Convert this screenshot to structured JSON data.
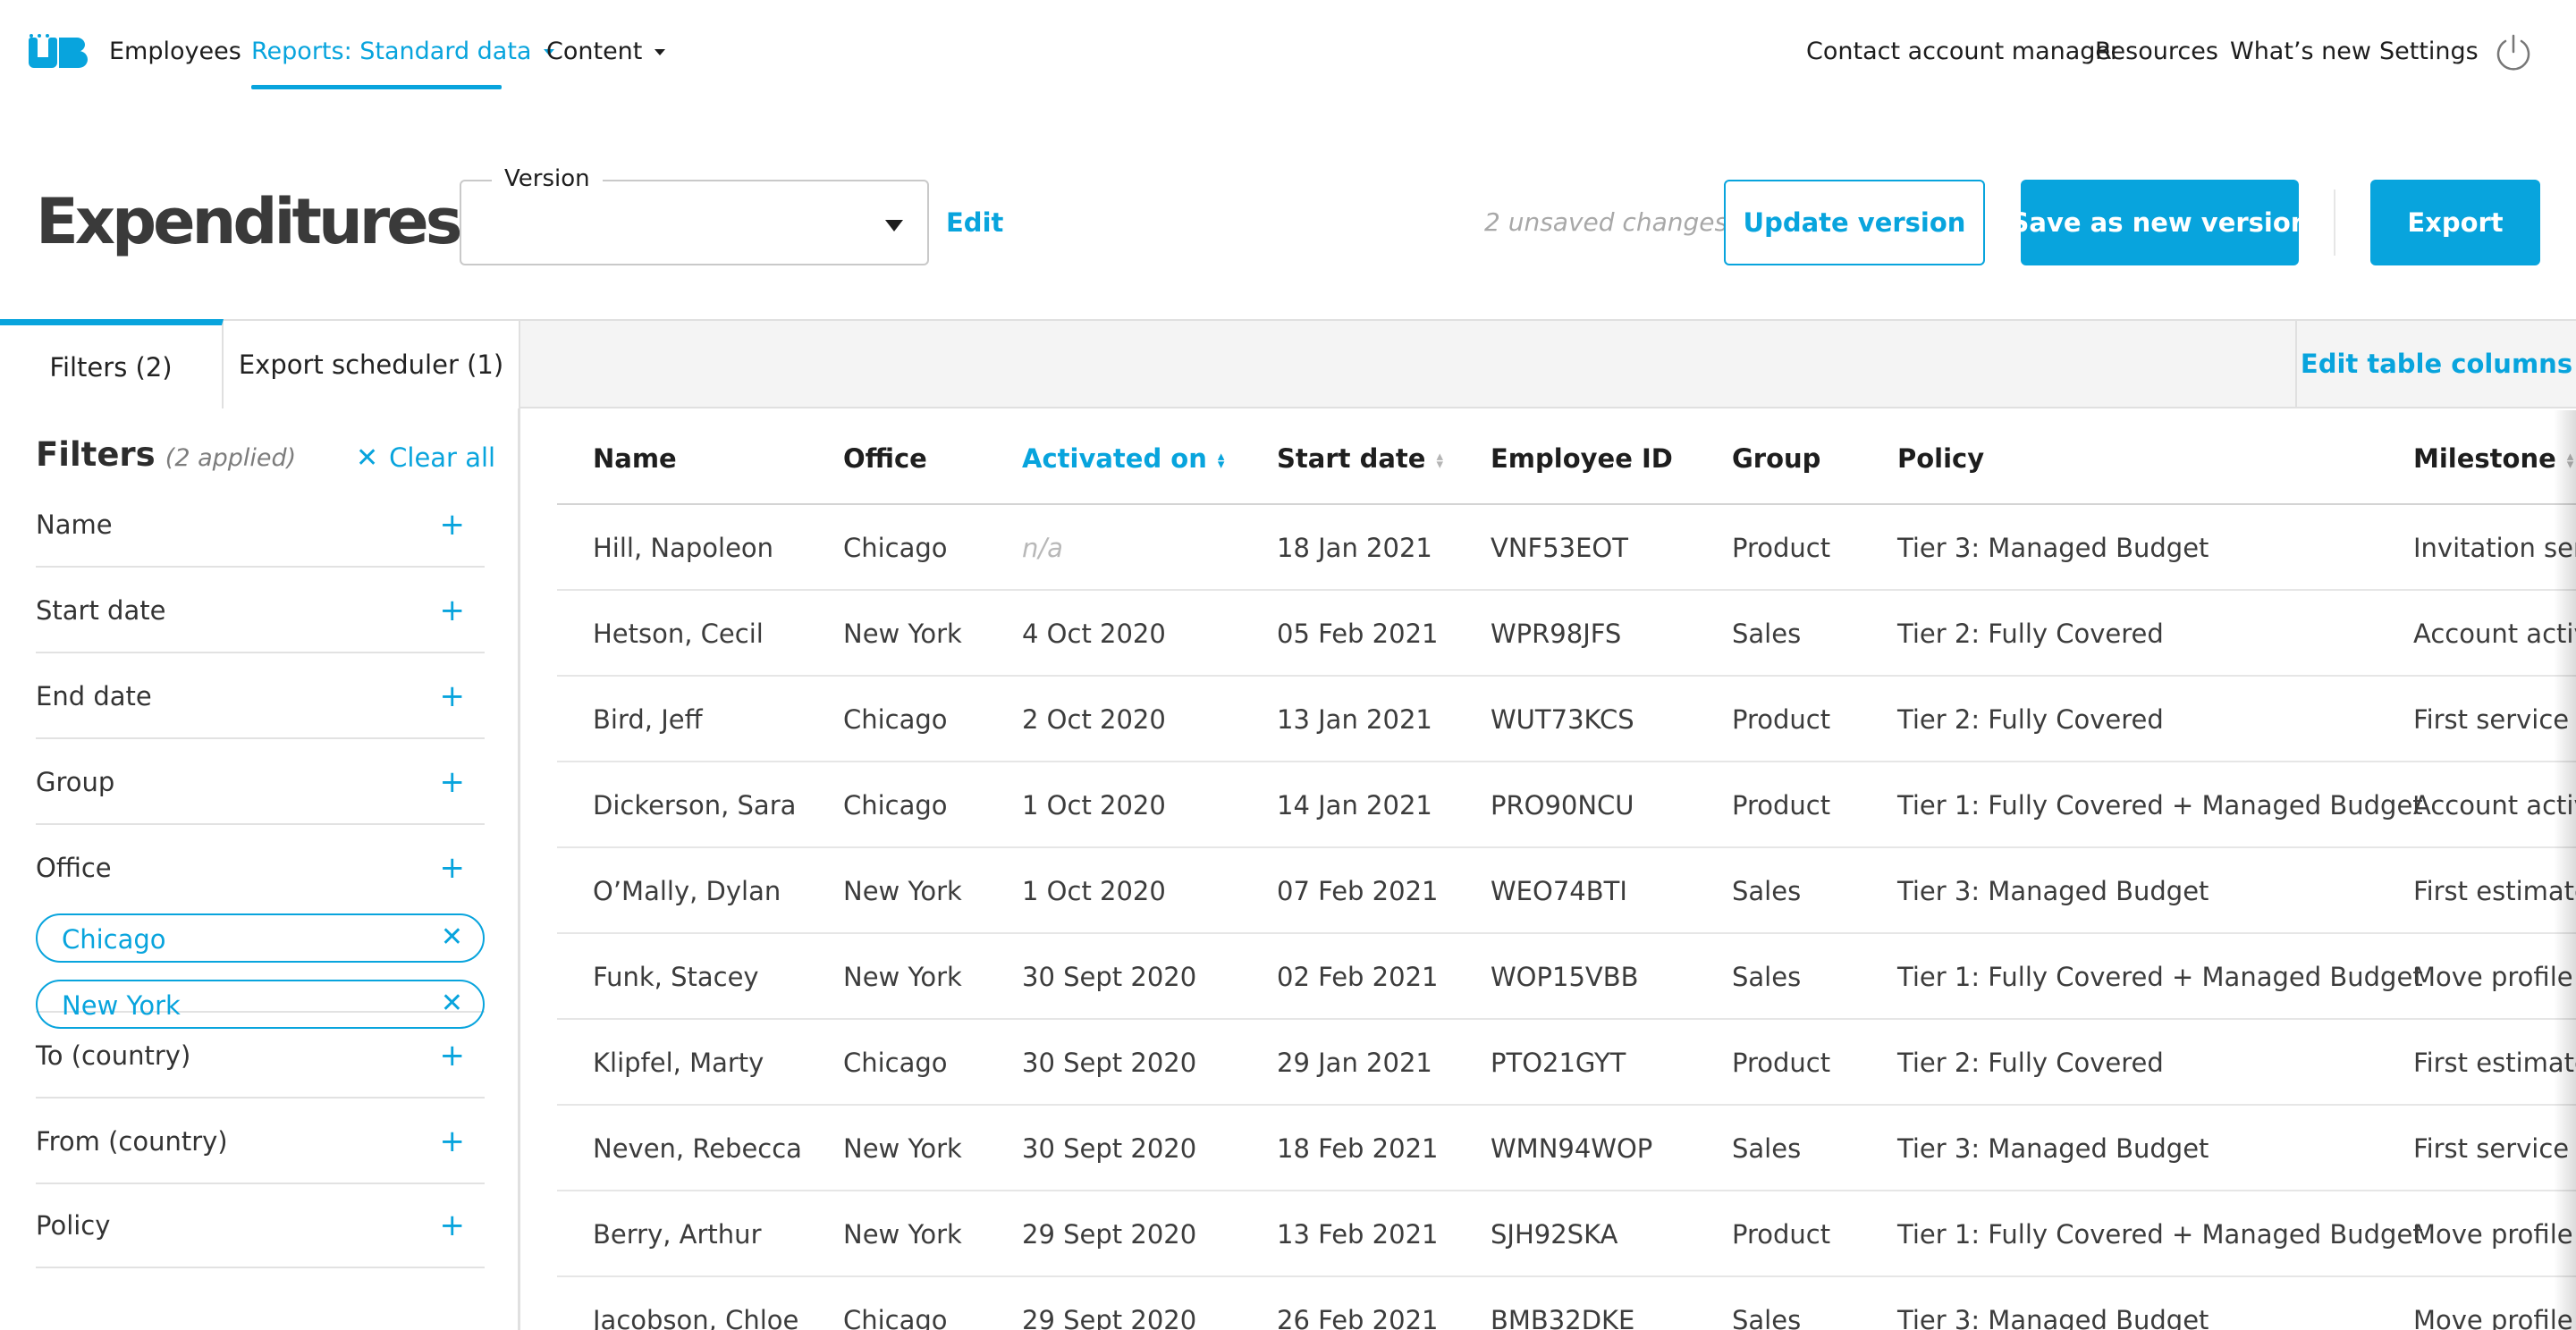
{
  "nav": {
    "logo_text": "UB",
    "links": [
      "Employees",
      "Reports: Standard data",
      "Content"
    ],
    "right_links": [
      "Contact account manager",
      "Resources",
      "What’s new",
      "Settings"
    ]
  },
  "header": {
    "title": "Expenditures",
    "version_label": "Version",
    "version_value": "",
    "edit": "Edit",
    "unsaved": "2 unsaved changes.",
    "update_btn": "Update version",
    "save_btn": "Save as new version",
    "export_btn": "Export"
  },
  "tabs": {
    "filters": "Filters (2)",
    "export_scheduler": "Export scheduler (1)",
    "edit_columns": "Edit table columns"
  },
  "sidebar": {
    "title": "Filters",
    "applied": "(2 applied)",
    "clear_all": "Clear all",
    "filters": [
      "Name",
      "Start date",
      "End date",
      "Group",
      "Office",
      "To (country)",
      "From (country)",
      "Policy"
    ],
    "office_chips": [
      "Chicago",
      "New York"
    ]
  },
  "table": {
    "columns": [
      "Name",
      "Office",
      "Activated on",
      "Start date",
      "Employee ID",
      "Group",
      "Policy",
      "Milestone"
    ],
    "rows": [
      [
        "Hill, Napoleon",
        "Chicago",
        "n/a",
        "18 Jan 2021",
        "VNF53EOT",
        "Product",
        "Tier 3: Managed Budget",
        "Invitation sent"
      ],
      [
        "Hetson, Cecil",
        "New York",
        "4 Oct 2020",
        "05 Feb 2021",
        "WPR98JFS",
        "Sales",
        "Tier 2: Fully Covered",
        "Account activa"
      ],
      [
        "Bird, Jeff",
        "Chicago",
        "2 Oct 2020",
        "13 Jan 2021",
        "WUT73KCS",
        "Product",
        "Tier 2: Fully Covered",
        "First service bo"
      ],
      [
        "Dickerson, Sara",
        "Chicago",
        "1 Oct 2020",
        "14 Jan 2021",
        "PRO90NCU",
        "Product",
        "Tier 1: Fully Covered + Managed Budget",
        "Account activa"
      ],
      [
        "O’Mally, Dylan",
        "New York",
        "1 Oct 2020",
        "07 Feb 2021",
        "WEO74BTI",
        "Sales",
        "Tier 3: Managed Budget",
        "First estimate r"
      ],
      [
        "Funk, Stacey",
        "New York",
        "30 Sept 2020",
        "02 Feb 2021",
        "WOP15VBB",
        "Sales",
        "Tier 1: Fully Covered + Managed Budget",
        "Move profile co"
      ],
      [
        "Klipfel, Marty",
        "Chicago",
        "30 Sept 2020",
        "29 Jan 2021",
        "PTO21GYT",
        "Product",
        "Tier 2: Fully Covered",
        "First estimate r"
      ],
      [
        "Neven, Rebecca",
        "New York",
        "30 Sept 2020",
        "18 Feb 2021",
        "WMN94WOP",
        "Sales",
        "Tier 3: Managed Budget",
        "First service bo"
      ],
      [
        "Berry, Arthur",
        "New York",
        "29 Sept 2020",
        "13 Feb 2021",
        "SJH92SKA",
        "Product",
        "Tier 1: Fully Covered + Managed Budget",
        "Move profile co"
      ],
      [
        "Jacobson, Chloe",
        "Chicago",
        "29 Sept 2020",
        "26 Feb 2021",
        "BMB32DKE",
        "Sales",
        "Tier 3: Managed Budget",
        "Move profile co"
      ]
    ]
  },
  "colors": {
    "accent": "#08a4dd",
    "text": "#222222",
    "muted": "#a8a8a8"
  },
  "icons": [
    "logo-icon",
    "caret-down-icon",
    "power-icon",
    "close-icon",
    "plus-icon",
    "sort-icon"
  ]
}
